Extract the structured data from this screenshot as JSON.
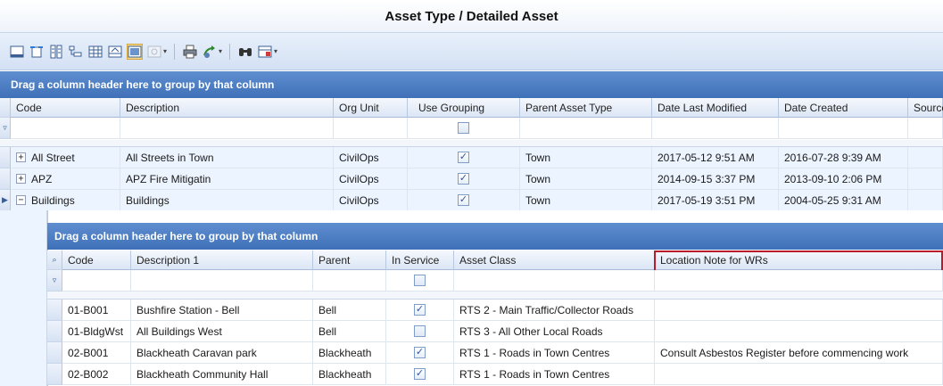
{
  "title": "Asset Type / Detailed Asset",
  "toolbar": {
    "icons": [
      "footer-icon",
      "best-fit-icon",
      "column-chooser-icon",
      "group-panel-icon",
      "grid-lines-icon",
      "header-icon",
      "layout-icon",
      "preview-icon",
      "print-icon",
      "export-icon",
      "find-icon",
      "options-icon"
    ]
  },
  "outer": {
    "group_hint": "Drag a column header here to group by that column",
    "columns": [
      "Code",
      "Description",
      "Org Unit",
      "Use Grouping",
      "Parent Asset Type",
      "Date Last Modified",
      "Date Created",
      "Source"
    ],
    "rows": [
      {
        "expander": "+",
        "code": "All Street",
        "description": "All Streets in Town",
        "org_unit": "CivilOps",
        "use_grouping": true,
        "parent": "Town",
        "modified": "2017-05-12 9:51 AM",
        "created": "2016-07-28 9:39 AM"
      },
      {
        "expander": "+",
        "code": "APZ",
        "description": "APZ Fire Mitigatin",
        "org_unit": "CivilOps",
        "use_grouping": true,
        "parent": "Town",
        "modified": "2014-09-15 3:37 PM",
        "created": "2013-09-10 2:06 PM"
      },
      {
        "expander": "−",
        "code": "Buildings",
        "description": "Buildings",
        "org_unit": "CivilOps",
        "use_grouping": true,
        "parent": "Town",
        "modified": "2017-05-19 3:51 PM",
        "created": "2004-05-25 9:31 AM"
      }
    ]
  },
  "inner": {
    "group_hint": "Drag a column header here to group by that column",
    "columns": [
      "Code",
      "Description 1",
      "Parent",
      "In Service",
      "Asset Class",
      "Location Note for WRs"
    ],
    "rows": [
      {
        "code": "01-B001",
        "description": "Bushfire Station - Bell",
        "parent": "Bell",
        "in_service": true,
        "asset_class": "RTS 2 - Main Traffic/Collector Roads",
        "note": ""
      },
      {
        "code": "01-BldgWst",
        "description": "All Buildings West",
        "parent": "Bell",
        "in_service": false,
        "asset_class": "RTS 3 - All Other Local Roads",
        "note": ""
      },
      {
        "code": "02-B001",
        "description": "Blackheath Caravan park",
        "parent": "Blackheath",
        "in_service": true,
        "asset_class": "RTS 1 - Roads in Town Centres",
        "note": "Consult Asbestos Register before commencing work"
      },
      {
        "code": "02-B002",
        "description": "Blackheath Community Hall",
        "parent": "Blackheath",
        "in_service": true,
        "asset_class": "RTS 1 - Roads in Town Centres",
        "note": ""
      }
    ]
  },
  "colors": {
    "header_blue": "#3f71b8",
    "highlight_red": "#b71c2b",
    "row_tint": "#ecf4ff"
  }
}
